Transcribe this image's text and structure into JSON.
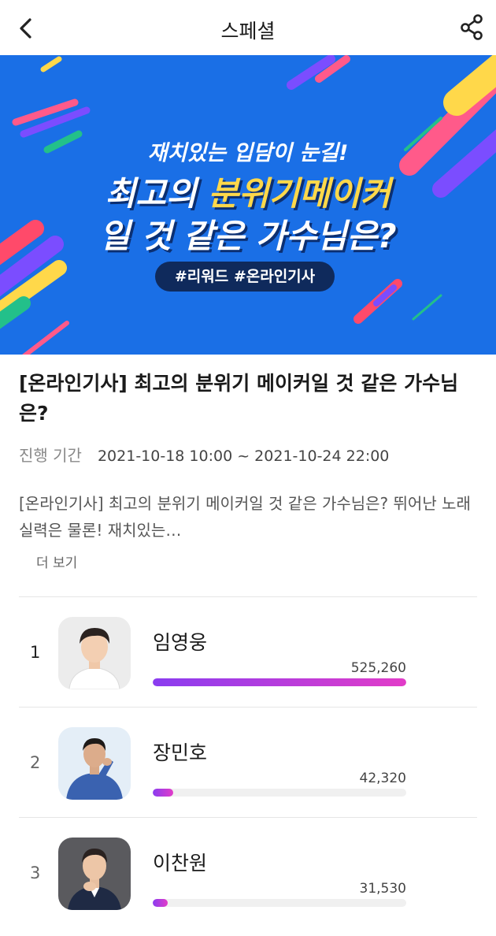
{
  "header": {
    "title": "스페셜",
    "back_icon": "chevron-left-icon",
    "share_icon": "share-icon"
  },
  "banner": {
    "subtitle": "재치있는 입담이 눈길!",
    "line1_prefix": "최고의 ",
    "line1_highlight": "분위기메이커",
    "line2": "일 것 같은 가수님은?",
    "tags": "#리워드 #온라인기사",
    "colors": {
      "background": "#1a6fe6",
      "highlight": "#ffd84a"
    }
  },
  "article": {
    "title": "[온라인기사] 최고의 분위기 메이커일 것 같은 가수님은?",
    "period_label": "진행 기간",
    "period_value": "2021-10-18 10:00 ~ 2021-10-24 22:00",
    "description": "[온라인기사] 최고의 분위기 메이커일 것 같은 가수님은? 뛰어난 노래실력은 물론! 재치있는…",
    "more_label": "더 보기"
  },
  "rankings": [
    {
      "rank": "1",
      "name": "임영웅",
      "votes": "525,260",
      "share": 1.0
    },
    {
      "rank": "2",
      "name": "장민호",
      "votes": "42,320",
      "share": 0.08
    },
    {
      "rank": "3",
      "name": "이찬원",
      "votes": "31,530",
      "share": 0.06
    }
  ],
  "colors": {
    "bar_start": "#8a3cf0",
    "bar_end": "#e23cc8"
  }
}
